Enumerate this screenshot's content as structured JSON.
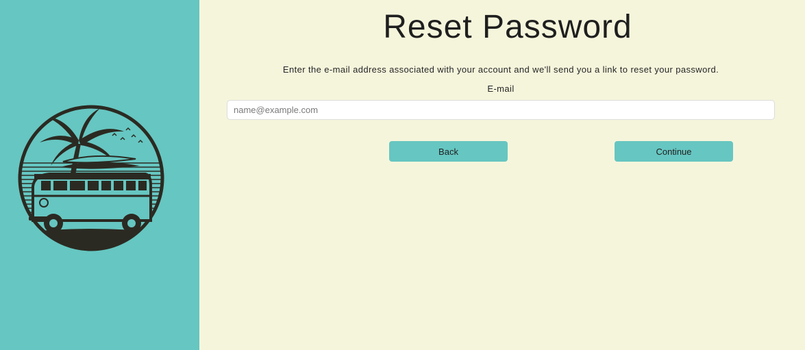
{
  "page": {
    "title": "Reset Password",
    "description": "Enter the e-mail address associated with your account and we'll send you a link to reset your password."
  },
  "form": {
    "email_label": "E-mail",
    "email_placeholder": "name@example.com",
    "email_value": ""
  },
  "buttons": {
    "back_label": "Back",
    "continue_label": "Continue"
  },
  "logo": {
    "icon": "camper-van-palm-tree-icon"
  },
  "colors": {
    "sidebar": "#66c6c1",
    "background": "#f5f5dc",
    "button": "#66c6c1",
    "logo_ink": "#2b2a22"
  }
}
